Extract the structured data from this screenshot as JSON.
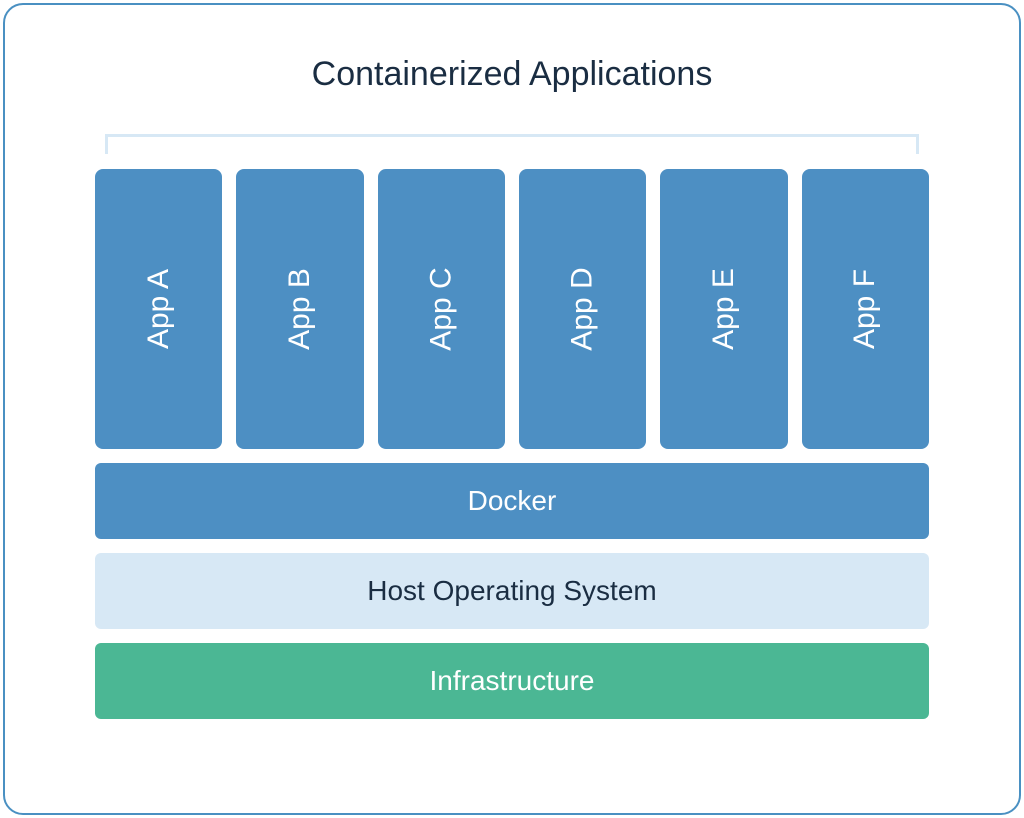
{
  "title": "Containerized Applications",
  "apps": [
    {
      "label": "App A"
    },
    {
      "label": "App B"
    },
    {
      "label": "App C"
    },
    {
      "label": "App D"
    },
    {
      "label": "App E"
    },
    {
      "label": "App F"
    }
  ],
  "layers": {
    "docker": "Docker",
    "host": "Host Operating System",
    "infrastructure": "Infrastructure"
  },
  "colors": {
    "border": "#4a90c2",
    "app_bg": "#4d8fc3",
    "docker_bg": "#4d8fc3",
    "host_bg": "#d7e8f5",
    "infra_bg": "#4bb794",
    "text_dark": "#1a2d42",
    "text_light": "#ffffff",
    "bracket": "#d7e8f5"
  }
}
